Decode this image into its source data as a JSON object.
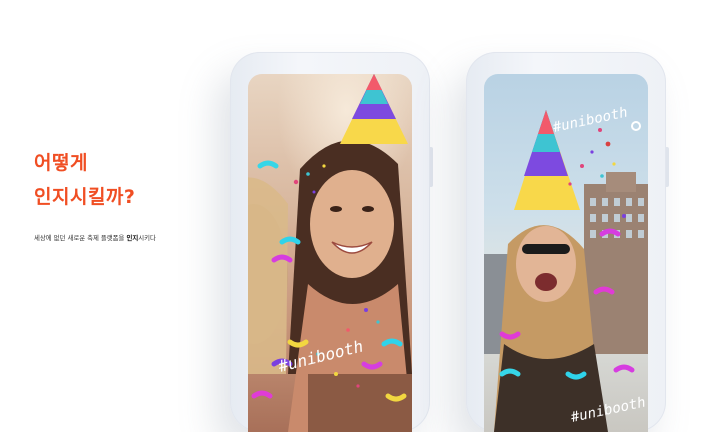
{
  "headline": {
    "line1": "어떻게",
    "line2": "인지시킬까?"
  },
  "subtitle": {
    "before": "세상에 없던 새로운 축제 플랫폼을 ",
    "bold": "인지",
    "after": "시키다"
  },
  "phones": [
    {
      "hashtag": "#unibooth"
    },
    {
      "hashtag": "#unibooth"
    }
  ],
  "colors": {
    "accent": "#f04e23"
  }
}
